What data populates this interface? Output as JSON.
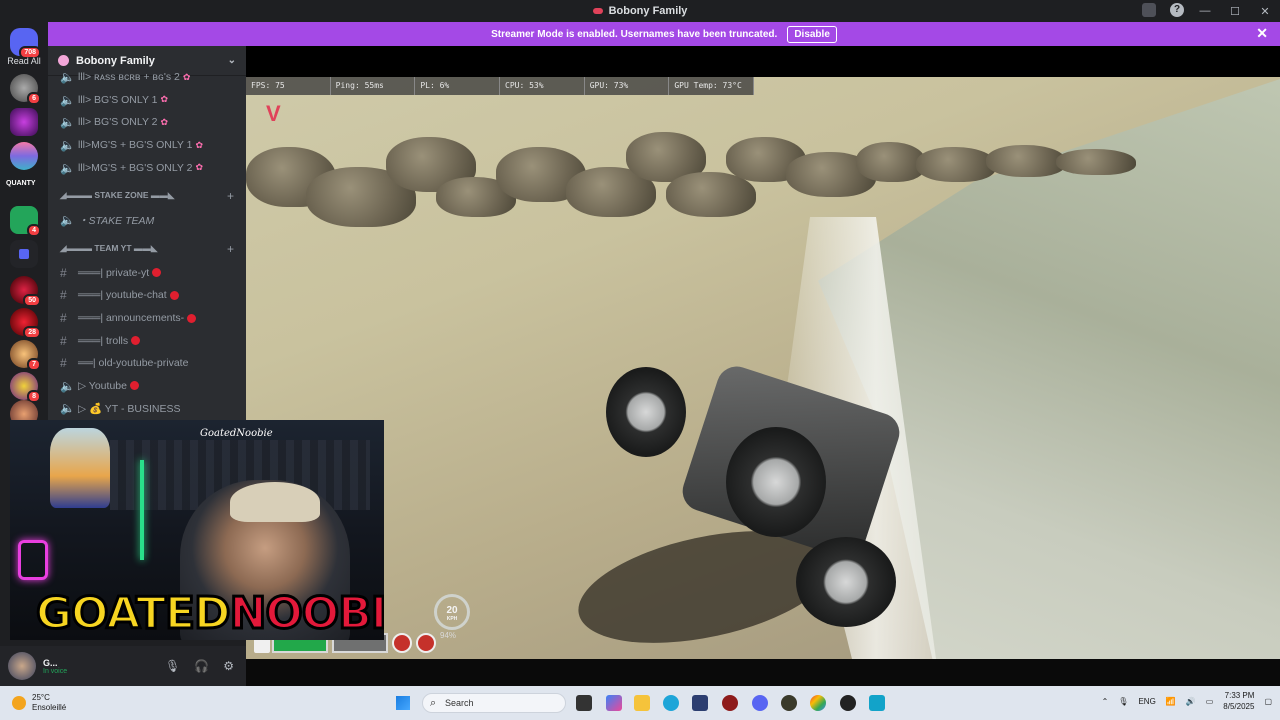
{
  "window": {
    "title": "Bobony Family",
    "controls": [
      "—",
      "☐",
      "✕"
    ]
  },
  "banner": {
    "text": "Streamer Mode is enabled. Usernames have been truncated.",
    "disable_label": "Disable",
    "close_glyph": "✕"
  },
  "servers": {
    "read_all": "Read All",
    "top_badge": "708",
    "items": [
      {
        "badge": "6"
      },
      {
        "badge": ""
      },
      {
        "badge": ""
      },
      {
        "badge": ""
      },
      {
        "badge": "4"
      },
      {
        "badge": ""
      },
      {
        "badge": "50"
      },
      {
        "badge": "28"
      },
      {
        "badge": "7"
      },
      {
        "badge": "8"
      },
      {
        "badge": ""
      }
    ],
    "wordmark": "QUANTY"
  },
  "guild": {
    "name": "Bobony Family",
    "channels_top": [
      {
        "icon": "speaker",
        "name": "lll> ʀᴀss ʙᴄʀʙ + ʙɢ's 2",
        "flower": true
      },
      {
        "icon": "speaker",
        "name": "lll> BG'S ONLY 1",
        "flower": true
      },
      {
        "icon": "speaker",
        "name": "lll> BG'S ONLY 2",
        "flower": true
      },
      {
        "icon": "speaker",
        "name": "lll>MG'S + BG'S ONLY 1",
        "flower": true
      },
      {
        "icon": "speaker",
        "name": "lll>MG'S + BG'S ONLY 2",
        "flower": true
      }
    ],
    "category_stake": "◢▬▬▬ STAKE ZONE ▬▬◣",
    "stake_channel": "・STAKE TEAM",
    "category_yt": "◢▬▬▬ TEAM YT ▬▬◣",
    "yt_channels": [
      {
        "icon": "#",
        "name": "═══| private-yt",
        "dot": true
      },
      {
        "icon": "#",
        "name": "═══| youtube-chat",
        "dot": true
      },
      {
        "icon": "#",
        "name": "═══| announcements-",
        "dot": true
      },
      {
        "icon": "#",
        "name": "═══| trolls",
        "dot": true
      },
      {
        "icon": "#",
        "name": "══| old-youtube-private",
        "dot": false
      },
      {
        "icon": "speaker",
        "name": "▷ Youtube",
        "dot": true
      },
      {
        "icon": "speaker",
        "name": "▷ 💰 YT - BUSINESS",
        "dot": false
      }
    ]
  },
  "game_hud": {
    "fps": "FPS: 75",
    "ping": "Ping: 55ms",
    "pl": "PL: 6%",
    "cpu": "CPU: 53%",
    "gpu": "GPU: 73%",
    "gpu_temp": "GPU Temp: 73°C",
    "speed": "20",
    "speed_unit": "KPH",
    "percent": "94%"
  },
  "webcam": {
    "tag": "GoatedNoobie",
    "name_a": "GOATED",
    "name_b": "NOOBIE"
  },
  "user_panel": {
    "name": "G...",
    "status": "In voice"
  },
  "taskbar": {
    "temperature": "25°C",
    "weather": "Ensoleillé",
    "search_placeholder": "Search",
    "language": "ENG",
    "time": "7:33 PM",
    "date": "8/5/2025"
  },
  "colors": {
    "accent": "#a449e6",
    "discord_bg": "#2b2d31",
    "unread_dot": "#e01f2f",
    "health": "#22a84a"
  }
}
